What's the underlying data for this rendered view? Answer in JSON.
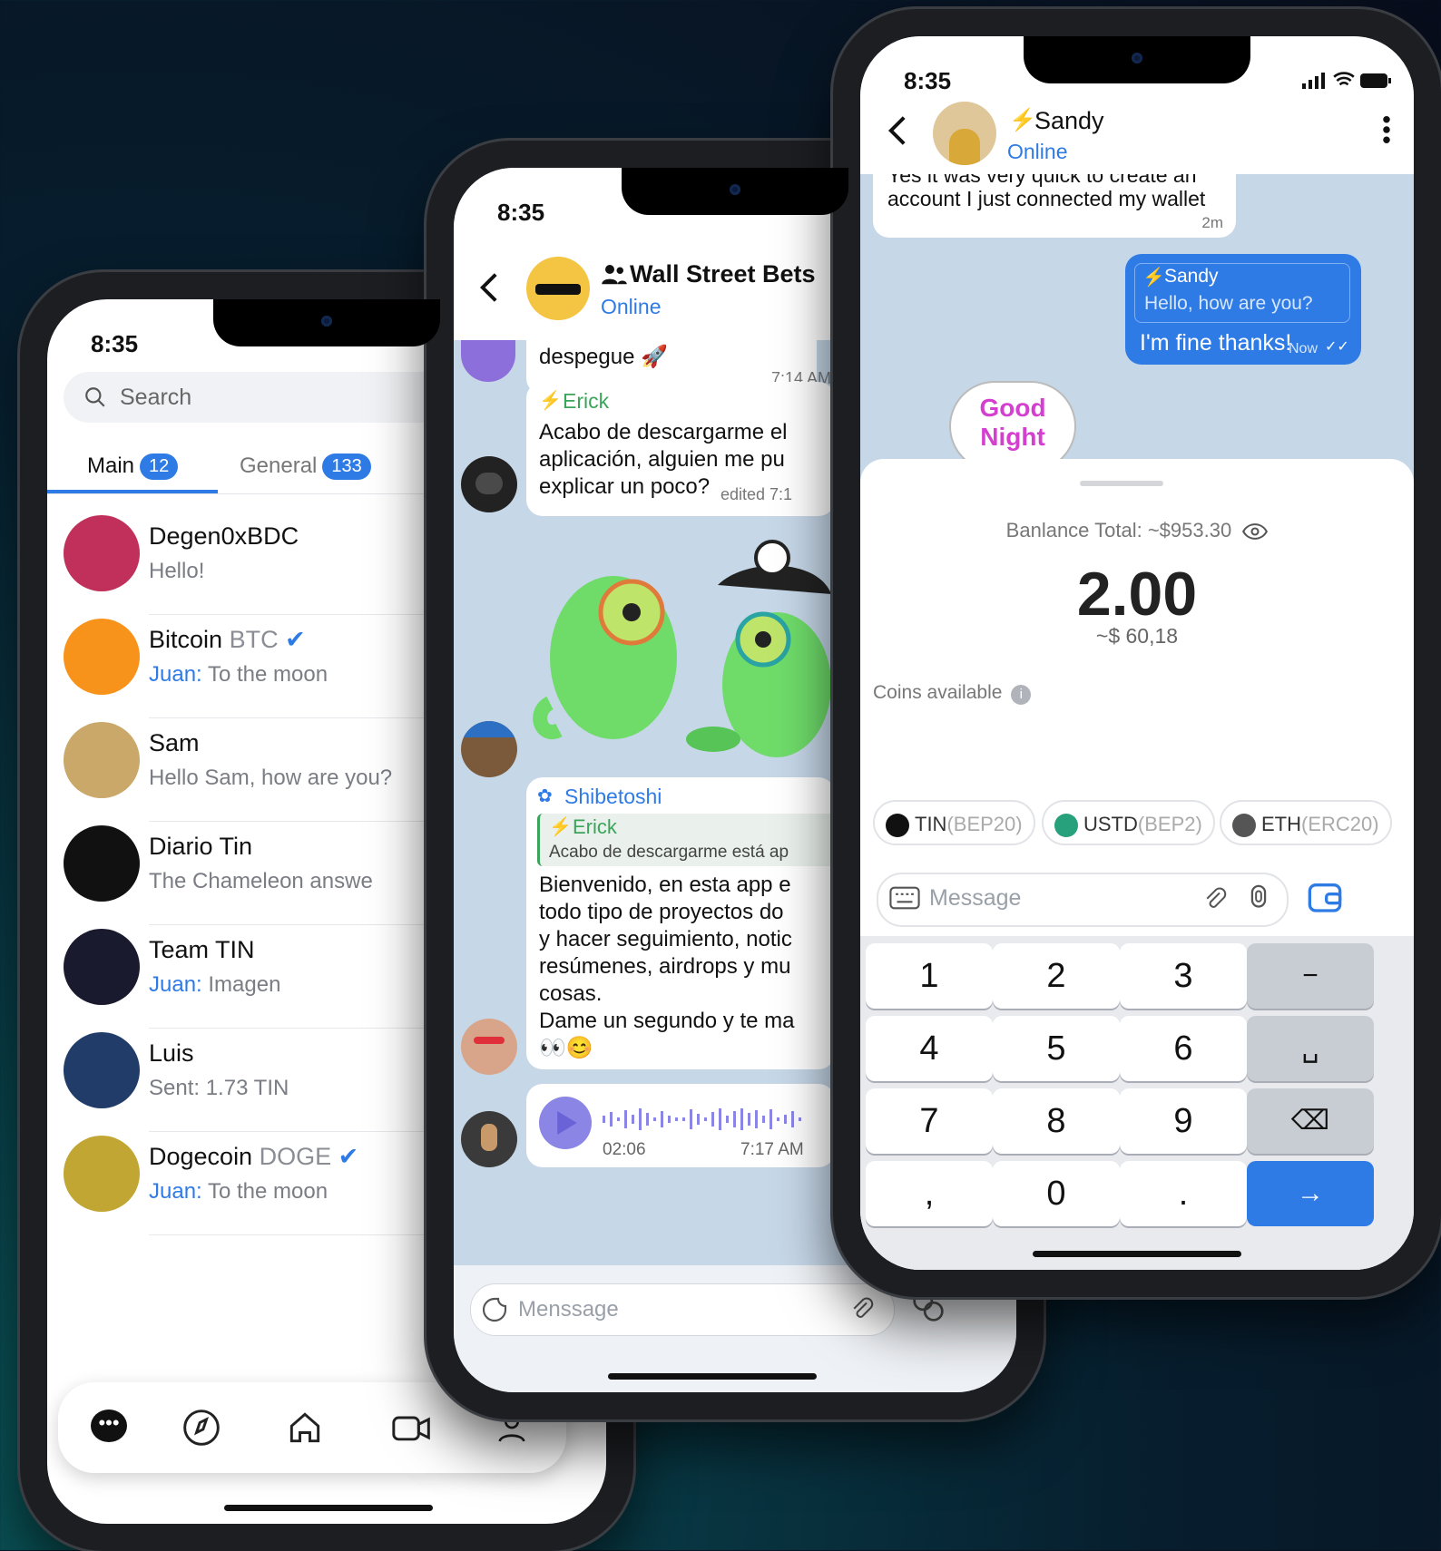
{
  "status_time": "8:35",
  "chat_list": {
    "search_placeholder": "Search",
    "tabs": [
      {
        "label": "Main",
        "count": "12"
      },
      {
        "label": "General",
        "count": "133"
      }
    ],
    "chats": [
      {
        "name": "Degen0xBDC",
        "tag": "",
        "preview_sender": "",
        "preview": "Hello!",
        "avatar_color": "#c0305a"
      },
      {
        "name": "Bitcoin",
        "tag": "BTC",
        "preview_sender": "Juan:",
        "preview": "To the moon",
        "avatar_color": "#f7931a"
      },
      {
        "name": "Sam",
        "tag": "",
        "preview_sender": "",
        "preview": "Hello Sam, how are you?",
        "avatar_color": "#c9a86a"
      },
      {
        "name": "Diario Tin",
        "tag": "",
        "preview_sender": "",
        "preview": "The Chameleon answe",
        "avatar_color": "#111111"
      },
      {
        "name": "Team TIN",
        "tag": "",
        "preview_sender": "Juan:",
        "preview": "Imagen",
        "avatar_color": "#1a1a2e"
      },
      {
        "name": "Luis",
        "tag": "",
        "preview_sender": "",
        "preview": "Sent: 1.73 TIN",
        "avatar_color": "#223c6a"
      },
      {
        "name": "Dogecoin",
        "tag": "DOGE",
        "preview_sender": "Juan:",
        "preview": "To the moon",
        "avatar_color": "#c2a633"
      }
    ]
  },
  "group_chat": {
    "title": "Wall Street Bets",
    "status": "Online",
    "msg0_text": "despegue 🚀",
    "msg0_time": "7:14 AM",
    "msg1_sender": "Erick",
    "msg1_text_1": "Acabo de descargarme el",
    "msg1_text_2": "aplicación, alguien me pu",
    "msg1_text_3": "explicar un poco?",
    "msg1_meta": "edited 7:1",
    "msg2_sender": "Shibetoshi",
    "msg2_reply_sender": "Erick",
    "msg2_reply_text": "Acabo de descargarme está ap",
    "msg2_lines": [
      "Bienvenido, en esta app e",
      "todo tipo de proyectos do",
      "y hacer seguimiento, notic",
      "resúmenes, airdrops y mu",
      "cosas.",
      "Dame un segundo y te ma",
      "👀😊"
    ],
    "voice_duration": "02:06",
    "voice_time": "7:17 AM",
    "input_placeholder": "Menssage"
  },
  "wallet_chat": {
    "contact": "Sandy",
    "status": "Online",
    "in_msg_cut": "Yes it was very quick to create an",
    "in_msg": "account I just connected my wallet",
    "in_time": "2m",
    "reply_sender": "Sandy",
    "reply_text": "Hello, how are you?",
    "out_msg": "I'm fine thanks!",
    "out_time": "Now",
    "sticker_line1": "Good",
    "sticker_line2": "Night",
    "balance_label": "Banlance Total: ~$953.30",
    "amount": "2.00",
    "amount_fiat": "~$ 60,18",
    "coins_label": "Coins available",
    "coins": [
      {
        "symbol": "TIN",
        "network": "(BEP20)",
        "color": "#111111"
      },
      {
        "symbol": "USTD",
        "network": "(BEP2)",
        "color": "#26a17b"
      },
      {
        "symbol": "ETH",
        "network": "(ERC20)",
        "color": "#555555"
      }
    ],
    "message_placeholder": "Message",
    "keys": [
      "1",
      "2",
      "3",
      "−",
      "4",
      "5",
      "6",
      "␣",
      "7",
      "8",
      "9",
      "⌫",
      ",",
      "0",
      ".",
      "→"
    ]
  },
  "colors": {
    "accent": "#2f7be6",
    "outgoing_bubble": "#2f7be6",
    "chat_bg": "#c6d7e8"
  }
}
